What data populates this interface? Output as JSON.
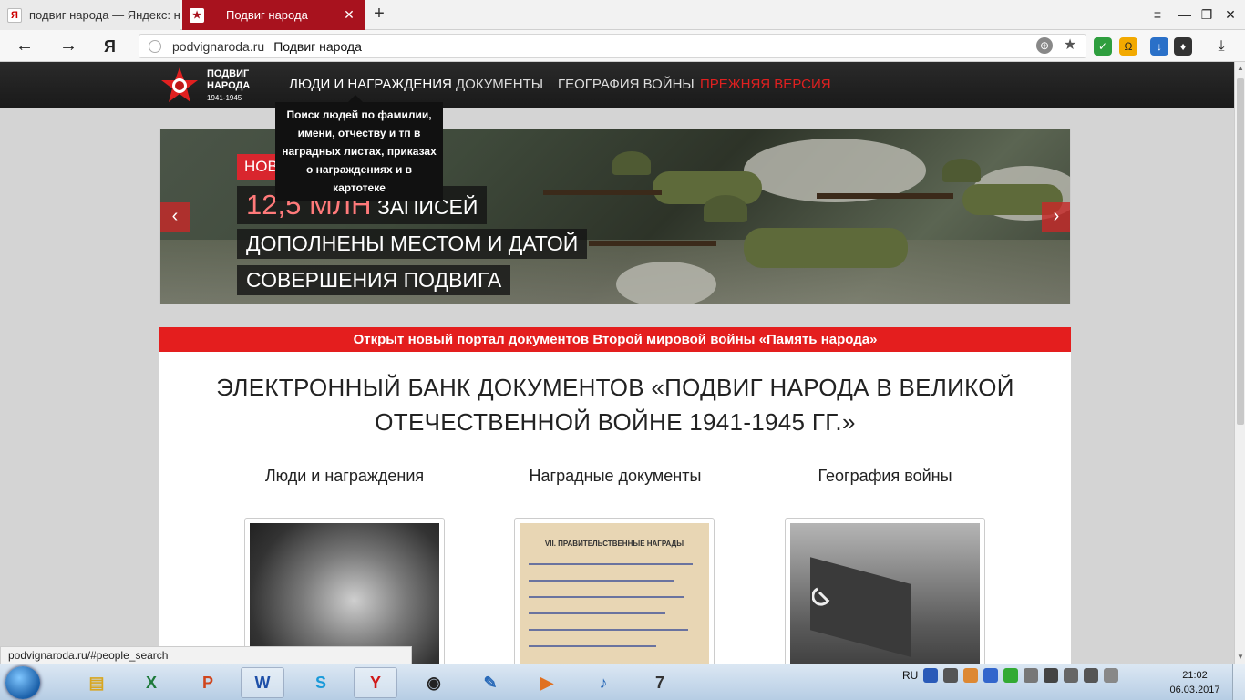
{
  "browser": {
    "tabs": [
      {
        "favicon": "Я",
        "title": "подвиг народа — Яндекс: н",
        "active": false
      },
      {
        "favicon": "★",
        "title": "Подвиг народа",
        "active": true
      }
    ],
    "new_tab": "+",
    "window_controls": {
      "menu": "≡",
      "minimize": "—",
      "restore": "❐",
      "close": "✕"
    },
    "nav": {
      "back": "←",
      "forward": "→",
      "yandex": "Я"
    },
    "address": {
      "host": "podvignaroda.ru",
      "page_title": "Подвиг народа"
    },
    "status_url": "podvignaroda.ru/#people_search"
  },
  "site": {
    "logo": {
      "line1": "ПОДВИГ",
      "line2": "НАРОДА",
      "years": "1941-1945"
    },
    "nav": [
      {
        "label": "ЛЮДИ И НАГРАЖДЕНИЯ",
        "active": true
      },
      {
        "label": "ДОКУМЕНТЫ",
        "active": false
      },
      {
        "label": "ГЕОГРАФИЯ ВОЙНЫ",
        "active": false
      },
      {
        "label": "ПРЕЖНЯЯ ВЕРСИЯ",
        "active": false
      }
    ],
    "tooltip": "Поиск людей по фамилии, имени, отчеству и тп в наградных листах, приказах о награждениях и в картотеке",
    "slider": {
      "tag": "НОВОЕ",
      "big_number": "12,5 МЛН",
      "line1_rest": " ЗАПИСЕЙ",
      "line2": "ДОПОЛНЕНЫ МЕСТОМ И ДАТОЙ",
      "line3": "СОВЕРШЕНИЯ ПОДВИГА",
      "prev": "‹",
      "next": "›"
    },
    "banner": {
      "text": "Открыт новый портал документов Второй мировой войны ",
      "link": "«Память народа»"
    },
    "heading": {
      "line1": "ЭЛЕКТРОННЫЙ БАНК ДОКУМЕНТОВ «ПОДВИГ НАРОДА В ВЕЛИКОЙ",
      "line2": "ОТЕЧЕСТВЕННОЙ ВОЙНЕ 1941-1945 ГГ.»"
    },
    "sections": [
      {
        "title": "Люди и награждения"
      },
      {
        "title": "Наградные документы",
        "doc_header": "VII. ПРАВИТЕЛЬСТВЕННЫЕ НАГРАДЫ"
      },
      {
        "title": "География войны"
      }
    ]
  },
  "taskbar": {
    "apps": [
      "explorer",
      "excel",
      "powerpoint",
      "word",
      "skype",
      "yandex",
      "steam",
      "tools",
      "media-player",
      "volume",
      "app-7"
    ],
    "tray": {
      "lang": "RU"
    },
    "clock": {
      "time": "21:02",
      "date": "06.03.2017"
    }
  }
}
